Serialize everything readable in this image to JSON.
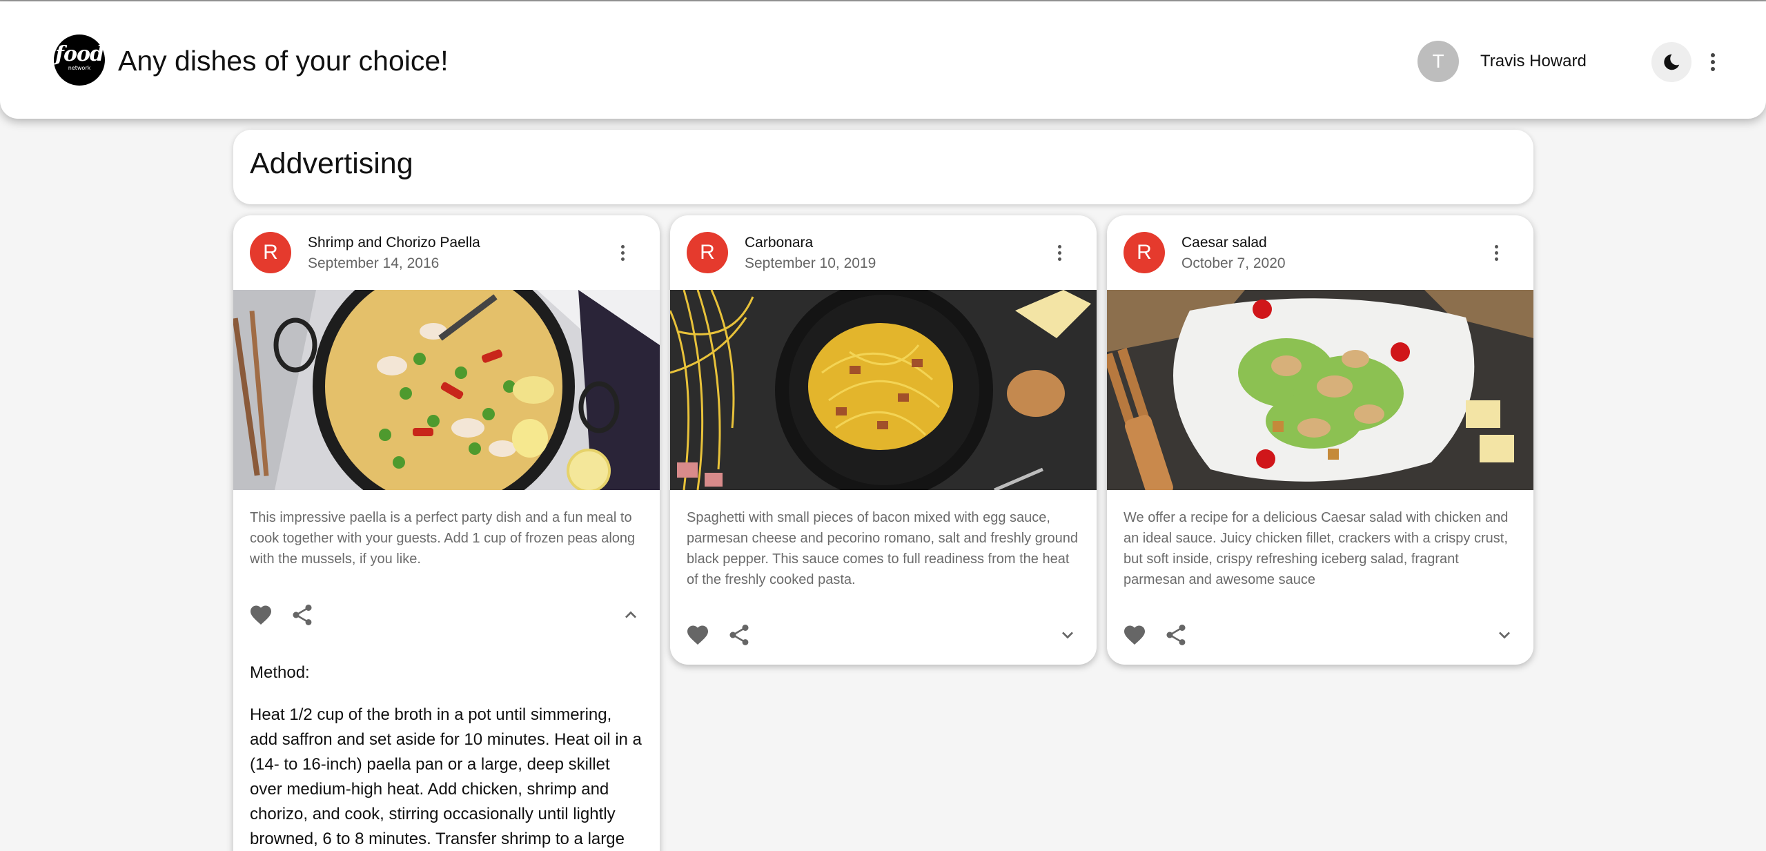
{
  "header": {
    "logo_text": "food",
    "logo_subtext": "network",
    "title": "Any dishes of your choice!",
    "user_initial": "T",
    "user_name": "Travis Howard",
    "theme_icon": "moon-icon",
    "more_icon": "more-vert-icon"
  },
  "ad": {
    "title": "Addvertising"
  },
  "colors": {
    "avatar_red": "#e53a2d",
    "user_avatar_gray": "#bdbdbd",
    "background": "#f5f5f5"
  },
  "cards": [
    {
      "avatar_letter": "R",
      "title": "Shrimp and Chorizo Paella",
      "date": "September 14, 2016",
      "image": "paella-image",
      "description": "This impressive paella is a perfect party dish and a fun meal to cook together with your guests. Add 1 cup of frozen peas along with the mussels, if you like.",
      "expanded": true,
      "method_label": "Method:",
      "method_text": "Heat 1/2 cup of the broth in a pot until simmering, add saffron and set aside for 10 minutes. Heat oil in a (14- to 16-inch) paella pan or a large, deep skillet over medium-high heat. Add chicken, shrimp and chorizo, and cook, stirring occasionally until lightly browned, 6 to 8 minutes. Transfer shrimp to a large"
    },
    {
      "avatar_letter": "R",
      "title": "Carbonara",
      "date": "September 10, 2019",
      "image": "carbonara-image",
      "description": "Spaghetti with small pieces of bacon mixed with egg sauce, parmesan cheese and pecorino romano, salt and freshly ground black pepper. This sauce comes to full readiness from the heat of the freshly cooked pasta.",
      "expanded": false
    },
    {
      "avatar_letter": "R",
      "title": "Caesar salad",
      "date": "October 7, 2020",
      "image": "caesar-salad-image",
      "description": "We offer a recipe for a delicious Caesar salad with chicken and an ideal sauce. Juicy chicken fillet, crackers with a crispy crust, but soft inside, crispy refreshing iceberg salad, fragrant parmesan and awesome sauce",
      "expanded": false
    }
  ]
}
